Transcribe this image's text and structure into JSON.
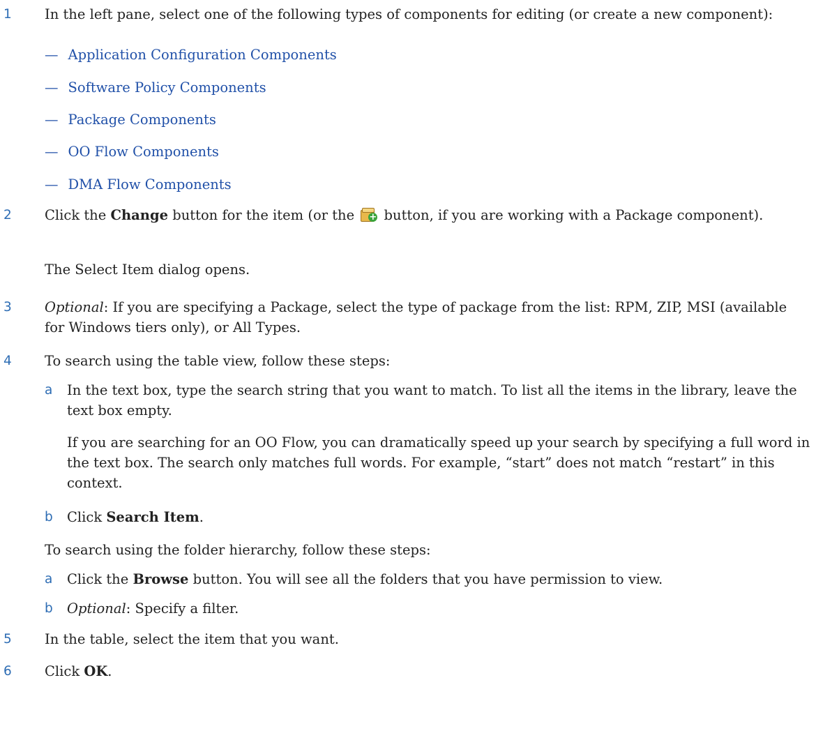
{
  "steps": {
    "s1": {
      "num": "1",
      "text": "In the left pane, select one of the following types of components for editing (or create a new component):",
      "links": [
        "Application Configuration Components",
        "Software Policy Components",
        "Package Components",
        "OO Flow Components",
        "DMA Flow Components"
      ],
      "dash": "—"
    },
    "s2": {
      "num": "2",
      "pre": "Click the ",
      "bold": "Change",
      "mid": " button for the item (or the ",
      "post": " button, if you are working with a Package component).",
      "icon": "package-add-icon",
      "note": "The Select Item dialog opens."
    },
    "s3": {
      "num": "3",
      "italic": "Optional",
      "text": ": If you are specifying a Package, select the type of package from the list: RPM, ZIP, MSI (available for Windows tiers only), or All Types."
    },
    "s4": {
      "num": "4",
      "text": "To search using the table view, follow these steps:",
      "a": {
        "label": "a",
        "text": "In the text box, type the search string that you want to match. To list all the items in the library, leave the text box empty.",
        "note": "If you are searching for an OO Flow, you can dramatically speed up your search by specifying a full word in the text box. The search only matches full words. For example, “start” does not match “restart” in this context."
      },
      "b": {
        "label": "b",
        "pre": "Click ",
        "bold": "Search Item",
        "post": "."
      },
      "folder_text": "To search using the folder hierarchy, follow these steps:",
      "fa": {
        "label": "a",
        "pre": "Click the ",
        "bold": "Browse",
        "post": " button. You will see all the folders that you have permission to view."
      },
      "fb": {
        "label": "b",
        "italic": "Optional",
        "post": ": Specify a filter."
      }
    },
    "s5": {
      "num": "5",
      "text": "In the table, select the item that you want."
    },
    "s6": {
      "num": "6",
      "pre": "Click ",
      "bold": "OK",
      "post": "."
    }
  },
  "colors": {
    "step_number": "#2e6db4",
    "link": "#2050a8",
    "text": "#222222"
  }
}
